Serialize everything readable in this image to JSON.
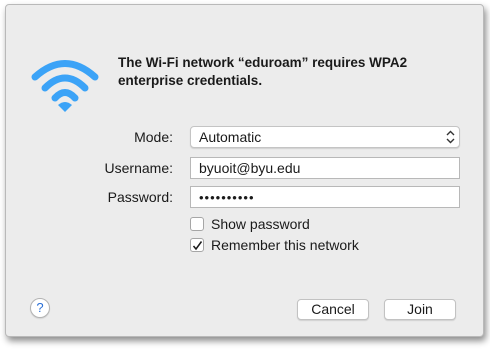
{
  "dialog": {
    "message": "The Wi-Fi network “eduroam” requires WPA2 enterprise credentials.",
    "icon": "wifi-icon",
    "accent_color": "#3ba3f7"
  },
  "form": {
    "mode_label": "Mode:",
    "mode_value": "Automatic",
    "username_label": "Username:",
    "username_value": "byuoit@byu.edu",
    "password_label": "Password:",
    "password_value": "••••••••••"
  },
  "options": {
    "show_password_label": "Show password",
    "show_password_checked": false,
    "remember_label": "Remember this network",
    "remember_checked": true
  },
  "buttons": {
    "help_label": "?",
    "cancel_label": "Cancel",
    "join_label": "Join"
  }
}
